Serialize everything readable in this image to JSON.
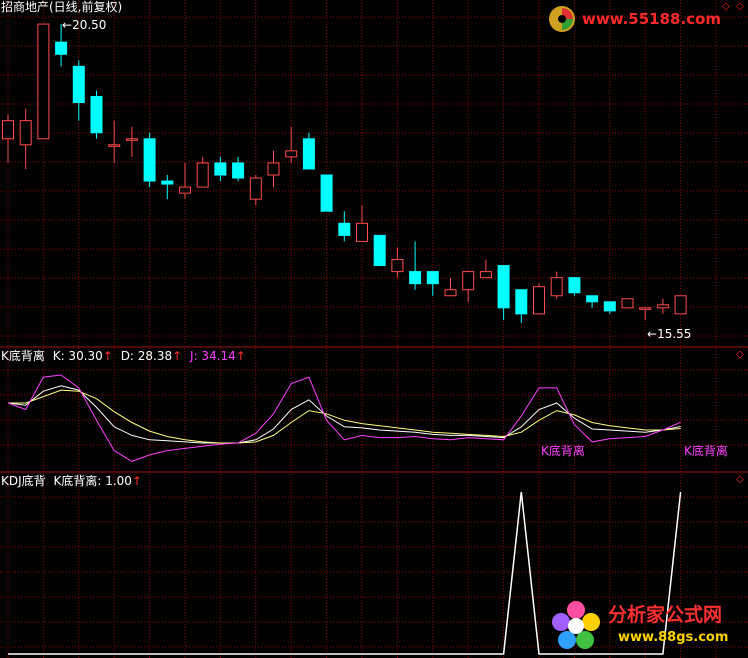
{
  "main_title": "招商地产(日线,前复权)",
  "kdj_header": {
    "name": "K底背离",
    "k_label": "K: 30.30",
    "d_label": "D: 28.38",
    "j_label": "J: 34.14",
    "arrow": "↑"
  },
  "signal_header": {
    "name": "KDJ底背",
    "value_label": "K底背离: 1.00",
    "arrow": "↑"
  },
  "price_high_label": "20.50",
  "price_low_label": "15.55",
  "divergence_labels": [
    "K底背离",
    "K底背离"
  ],
  "logo_top_text": "www.55188.com",
  "logo_bottom_text": "分析家公式网",
  "logo_bottom_url": "www.88gs.com",
  "colors": {
    "up": "#ff4c4c",
    "down": "#00ffff",
    "grid": "#8b0000",
    "k_line": "#ffffff",
    "d_line": "#ffff80",
    "j_line": "#ff40ff",
    "signal": "#ffffff"
  },
  "chart_data": [
    {
      "type": "candlestick",
      "title": "招商地产(日线,前复权)",
      "annotations": [
        "20.50",
        "15.55"
      ],
      "candles": [
        {
          "o": 18.6,
          "h": 19.0,
          "l": 18.2,
          "c": 18.9
        },
        {
          "o": 18.5,
          "h": 19.1,
          "l": 18.1,
          "c": 18.9
        },
        {
          "o": 18.6,
          "h": 20.5,
          "l": 18.6,
          "c": 20.5
        },
        {
          "o": 20.2,
          "h": 20.5,
          "l": 19.8,
          "c": 20.0
        },
        {
          "o": 19.8,
          "h": 19.9,
          "l": 18.9,
          "c": 19.2
        },
        {
          "o": 19.3,
          "h": 19.4,
          "l": 18.6,
          "c": 18.7
        },
        {
          "o": 18.5,
          "h": 18.9,
          "l": 18.2,
          "c": 18.5
        },
        {
          "o": 18.6,
          "h": 18.8,
          "l": 18.3,
          "c": 18.6
        },
        {
          "o": 18.6,
          "h": 18.7,
          "l": 17.8,
          "c": 17.9
        },
        {
          "o": 17.9,
          "h": 18.0,
          "l": 17.6,
          "c": 17.85
        },
        {
          "o": 17.7,
          "h": 18.2,
          "l": 17.6,
          "c": 17.8
        },
        {
          "o": 17.8,
          "h": 18.3,
          "l": 17.8,
          "c": 18.2
        },
        {
          "o": 18.2,
          "h": 18.3,
          "l": 17.9,
          "c": 18.0
        },
        {
          "o": 18.2,
          "h": 18.3,
          "l": 17.9,
          "c": 17.95
        },
        {
          "o": 17.6,
          "h": 18.0,
          "l": 17.5,
          "c": 17.95
        },
        {
          "o": 18.0,
          "h": 18.4,
          "l": 17.8,
          "c": 18.2
        },
        {
          "o": 18.3,
          "h": 18.8,
          "l": 18.2,
          "c": 18.4
        },
        {
          "o": 18.6,
          "h": 18.7,
          "l": 18.1,
          "c": 18.1
        },
        {
          "o": 18.0,
          "h": 18.0,
          "l": 17.4,
          "c": 17.4
        },
        {
          "o": 17.2,
          "h": 17.4,
          "l": 16.9,
          "c": 17.0
        },
        {
          "o": 16.9,
          "h": 17.5,
          "l": 16.9,
          "c": 17.2
        },
        {
          "o": 17.0,
          "h": 17.0,
          "l": 16.5,
          "c": 16.5
        },
        {
          "o": 16.4,
          "h": 16.8,
          "l": 16.3,
          "c": 16.6
        },
        {
          "o": 16.4,
          "h": 16.9,
          "l": 16.1,
          "c": 16.2
        },
        {
          "o": 16.4,
          "h": 16.4,
          "l": 16.0,
          "c": 16.2
        },
        {
          "o": 16.0,
          "h": 16.3,
          "l": 16.0,
          "c": 16.1
        },
        {
          "o": 16.1,
          "h": 16.4,
          "l": 15.9,
          "c": 16.4
        },
        {
          "o": 16.3,
          "h": 16.6,
          "l": 16.3,
          "c": 16.4
        },
        {
          "o": 16.5,
          "h": 16.5,
          "l": 15.6,
          "c": 15.8
        },
        {
          "o": 16.1,
          "h": 16.1,
          "l": 15.55,
          "c": 15.7
        },
        {
          "o": 15.7,
          "h": 16.2,
          "l": 15.7,
          "c": 16.15
        },
        {
          "o": 16.0,
          "h": 16.4,
          "l": 15.95,
          "c": 16.3
        },
        {
          "o": 16.3,
          "h": 16.3,
          "l": 16.0,
          "c": 16.05
        },
        {
          "o": 16.0,
          "h": 16.0,
          "l": 15.8,
          "c": 15.9
        },
        {
          "o": 15.9,
          "h": 15.9,
          "l": 15.7,
          "c": 15.75
        },
        {
          "o": 15.8,
          "h": 15.95,
          "l": 15.8,
          "c": 15.95
        },
        {
          "o": 15.8,
          "h": 15.8,
          "l": 15.6,
          "c": 15.8
        },
        {
          "o": 15.8,
          "h": 15.95,
          "l": 15.7,
          "c": 15.85
        },
        {
          "o": 15.7,
          "h": 16.0,
          "l": 15.7,
          "c": 16.0
        }
      ],
      "ylim": [
        15.35,
        20.7
      ]
    },
    {
      "type": "line",
      "title": "K底背离",
      "series": [
        {
          "name": "K",
          "values": [
            52,
            50,
            63,
            68,
            64,
            48,
            30,
            22,
            18,
            17,
            16,
            15,
            15,
            15,
            18,
            28,
            46,
            55,
            40,
            30,
            29,
            27,
            26,
            25,
            23,
            22,
            22,
            21,
            20,
            30,
            46,
            52,
            38,
            28,
            27,
            26,
            25,
            27,
            30.3
          ]
        },
        {
          "name": "D",
          "values": [
            52,
            52,
            58,
            64,
            63,
            56,
            44,
            34,
            26,
            21,
            18,
            16,
            15,
            15,
            16,
            22,
            34,
            45,
            42,
            36,
            33,
            31,
            29,
            27,
            25,
            24,
            23,
            22,
            21,
            25,
            36,
            45,
            41,
            34,
            31,
            29,
            27,
            27,
            28.38
          ]
        },
        {
          "name": "J",
          "values": [
            52,
            46,
            76,
            78,
            66,
            36,
            8,
            -2,
            4,
            8,
            10,
            12,
            14,
            15,
            24,
            42,
            70,
            76,
            36,
            18,
            22,
            20,
            20,
            21,
            19,
            18,
            20,
            19,
            18,
            40,
            66,
            66,
            32,
            16,
            19,
            20,
            21,
            27,
            34.14
          ]
        }
      ],
      "ylim": [
        -10,
        90
      ]
    },
    {
      "type": "line",
      "title": "KDJ底背",
      "series": [
        {
          "name": "K底背离",
          "values": [
            0,
            0,
            0,
            0,
            0,
            0,
            0,
            0,
            0,
            0,
            0,
            0,
            0,
            0,
            0,
            0,
            0,
            0,
            0,
            0,
            0,
            0,
            0,
            0,
            0,
            0,
            0,
            0,
            0,
            1,
            0,
            0,
            0,
            0,
            0,
            0,
            0,
            0,
            1
          ]
        }
      ],
      "ylim": [
        0,
        1
      ]
    }
  ]
}
